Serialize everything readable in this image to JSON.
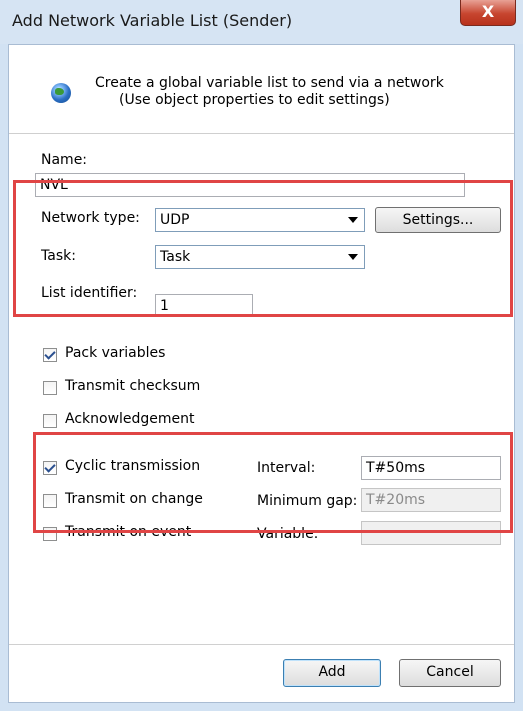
{
  "window": {
    "title": "Add Network Variable List (Sender)",
    "close_glyph": "X"
  },
  "header": {
    "line1": "Create a global variable list to send via a network",
    "line2": "(Use object properties to edit settings)",
    "icon": "globe-icon"
  },
  "name": {
    "label": "Name:",
    "value": "NVL"
  },
  "network_type": {
    "label": "Network type:",
    "value": "UDP"
  },
  "settings_button": "Settings...",
  "task": {
    "label": "Task:",
    "value": "Task"
  },
  "list_identifier": {
    "label": "List identifier:",
    "value": "1"
  },
  "options": {
    "pack_variables": {
      "label": "Pack variables",
      "checked": true
    },
    "transmit_checksum": {
      "label": "Transmit checksum",
      "checked": false
    },
    "acknowledgement": {
      "label": "Acknowledgement",
      "checked": false
    },
    "cyclic_transmission": {
      "label": "Cyclic transmission",
      "checked": true
    },
    "transmit_on_change": {
      "label": "Transmit on change",
      "checked": false
    },
    "transmit_on_event": {
      "label": "Transmit on event",
      "checked": false
    }
  },
  "interval": {
    "label": "Interval:",
    "value": "T#50ms"
  },
  "minimum_gap": {
    "label": "Minimum gap:",
    "value": "T#20ms"
  },
  "variable": {
    "label": "Variable:",
    "value": ""
  },
  "buttons": {
    "add": "Add",
    "cancel": "Cancel"
  },
  "colors": {
    "highlight_box": "#e04545",
    "window_frame": "#d2e2f3"
  }
}
